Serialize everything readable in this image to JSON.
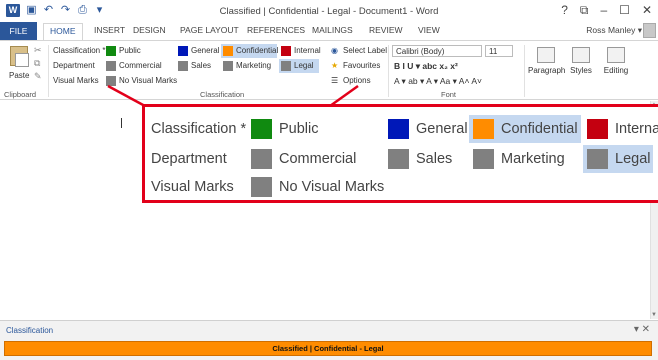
{
  "window": {
    "title": "Classified | Confidential - Legal - Document1 - Word",
    "controls": [
      "?",
      "⧉",
      "–",
      "☐",
      "✕"
    ]
  },
  "quick_access": {
    "icons": [
      "word-icon",
      "save-icon",
      "undo-icon",
      "redo-icon",
      "customize-icon"
    ]
  },
  "tabs": [
    "FILE",
    "HOME",
    "INSERT",
    "DESIGN",
    "PAGE LAYOUT",
    "REFERENCES",
    "MAILINGS",
    "REVIEW",
    "VIEW"
  ],
  "user": {
    "name": "Ross Manley ▾"
  },
  "ribbon": {
    "clipboard": {
      "paste_label": "Paste",
      "group_label": "Clipboard"
    },
    "classification": {
      "group_label": "Classification",
      "row_labels": [
        "Classification *",
        "Department",
        "Visual Marks"
      ],
      "items": [
        {
          "label": "Public",
          "color": "#108a10"
        },
        {
          "label": "General",
          "color": "#0018b8"
        },
        {
          "label": "Confidential",
          "color": "#ff8c00",
          "selected": true
        },
        {
          "label": "Internal",
          "color": "#c40010"
        },
        {
          "label": "Commercial",
          "color": "#808080"
        },
        {
          "label": "Sales",
          "color": "#808080"
        },
        {
          "label": "Marketing",
          "color": "#808080"
        },
        {
          "label": "Legal",
          "color": "#808080",
          "selected": true
        },
        {
          "label": "No Visual Marks",
          "color": "#808080"
        }
      ],
      "select_label": "Select Label",
      "favourites_label": "Favourites",
      "options_label": "Options"
    },
    "font": {
      "group_label": "Font",
      "font_name": "Calibri (Body)",
      "font_size": "11",
      "format_row1": "B  I  U  ▾ abc  x₂  x²",
      "format_row2": "A ▾  ab ▾  A ▾  Aa ▾   A˄  A˅"
    },
    "paragraph_label": "Paragraph",
    "styles_label": "Styles",
    "editing_label": "Editing"
  },
  "callout": {
    "classification_label": "Classification *",
    "department_label": "Department",
    "visual_marks_label": "Visual Marks",
    "public": "Public",
    "general": "General",
    "confidential": "Confidential",
    "internal": "Internal",
    "commercial": "Commercial",
    "sales": "Sales",
    "marketing": "Marketing",
    "legal": "Legal",
    "no_visual_marks": "No Visual Marks"
  },
  "pane": {
    "title": "Classification",
    "controls": "▾ ✕",
    "banner": "Classified | Confidential - Legal",
    "banner_color": "#ff8c00"
  }
}
